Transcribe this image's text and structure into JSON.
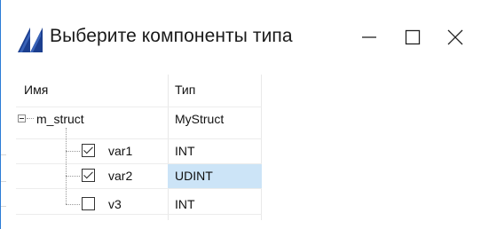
{
  "window": {
    "title": "Выберите компоненты типа"
  },
  "tree": {
    "columns": [
      "Имя",
      "Тип"
    ],
    "root": {
      "name": "m_struct",
      "type": "MyStruct",
      "expanded": true
    },
    "children": [
      {
        "name": "var1",
        "type": "INT",
        "checked": true,
        "selected": false
      },
      {
        "name": "var2",
        "type": "UDINT",
        "checked": true,
        "selected": true
      },
      {
        "name": "v3",
        "type": "INT",
        "checked": false,
        "selected": false
      }
    ]
  },
  "colors": {
    "accent": "#2b7bd6",
    "selection": "#cce4f7"
  },
  "icons": {
    "app": "app-logo-icon",
    "minimize": "minimize-icon",
    "maximize": "maximize-icon",
    "close": "close-icon"
  }
}
